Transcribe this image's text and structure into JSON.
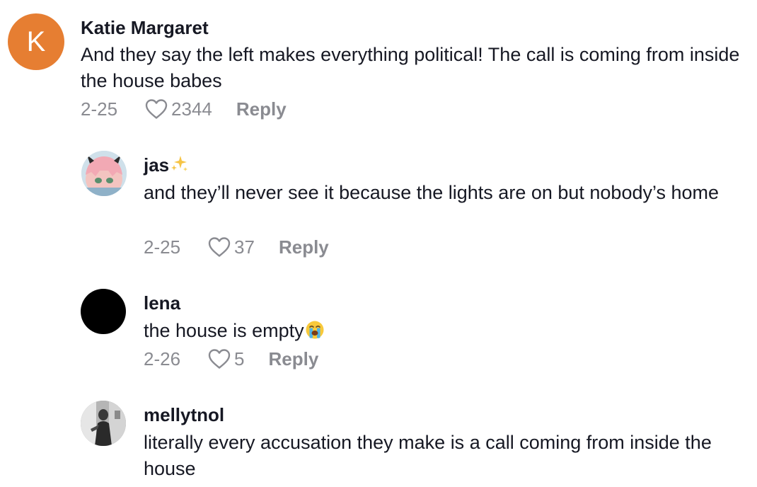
{
  "comments": [
    {
      "avatar_letter": "K",
      "avatar_color": "#e67e32",
      "username": "Katie Margaret",
      "text": "And they say the left makes everything political! The call is coming from inside the house babes",
      "date": "2-25",
      "likes": "2344",
      "reply_label": "Reply"
    },
    {
      "username": "jas",
      "username_emoji": "sparkles-icon",
      "text": "and they’ll never see it because the lights are on but nobody’s home",
      "date": "2-25",
      "likes": "37",
      "reply_label": "Reply"
    },
    {
      "username": "lena",
      "text": "the house is empty",
      "text_emoji": "loudly-crying-face-icon",
      "date": "2-26",
      "likes": "5",
      "reply_label": "Reply"
    },
    {
      "username": "mellytnol",
      "text": "literally every accusation they make is a call coming from inside the house"
    }
  ],
  "colors": {
    "text_primary": "#161823",
    "text_secondary": "#8a8b91",
    "background": "#ffffff"
  }
}
